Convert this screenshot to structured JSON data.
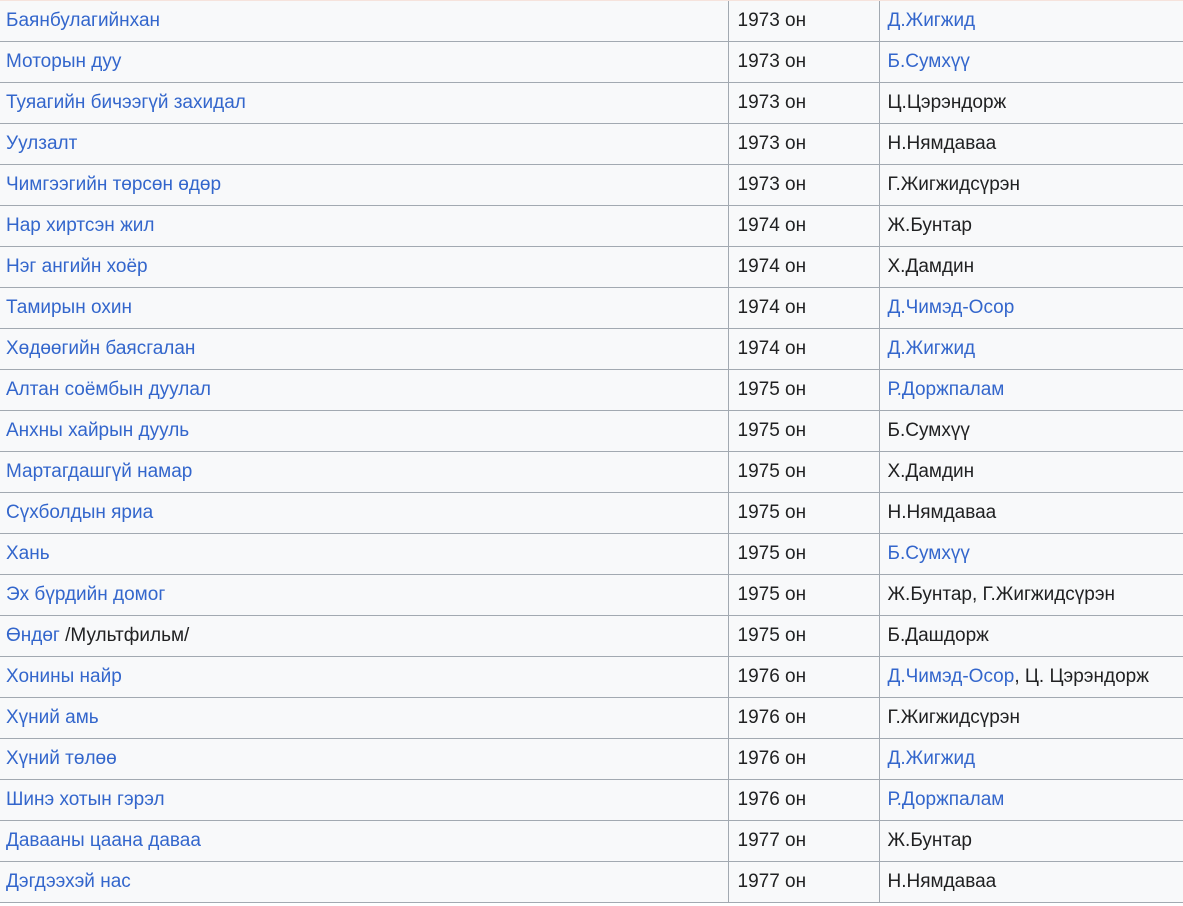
{
  "rows": [
    {
      "title": [
        {
          "text": "Баянбулагийнхан",
          "link": true
        }
      ],
      "year": "1973 он",
      "authors": [
        {
          "text": "Д.Жигжид",
          "link": true
        }
      ]
    },
    {
      "title": [
        {
          "text": "Моторын дуу",
          "link": true
        }
      ],
      "year": "1973 он",
      "authors": [
        {
          "text": "Б.Сумхүү",
          "link": true
        }
      ]
    },
    {
      "title": [
        {
          "text": "Туяагийн бичээгүй захидал",
          "link": true
        }
      ],
      "year": "1973 он",
      "authors": [
        {
          "text": "Ц.Цэрэндорж",
          "link": false
        }
      ]
    },
    {
      "title": [
        {
          "text": "Уулзалт",
          "link": true
        }
      ],
      "year": "1973 он",
      "authors": [
        {
          "text": "Н.Нямдаваа",
          "link": false
        }
      ]
    },
    {
      "title": [
        {
          "text": "Чимгээгийн төрсөн өдөр",
          "link": true
        }
      ],
      "year": "1973 он",
      "authors": [
        {
          "text": "Г.Жигжидсүрэн",
          "link": false
        }
      ]
    },
    {
      "title": [
        {
          "text": "Нар хиртсэн жил",
          "link": true
        }
      ],
      "year": "1974 он",
      "authors": [
        {
          "text": "Ж.Бунтар",
          "link": false
        }
      ]
    },
    {
      "title": [
        {
          "text": "Нэг ангийн хоёр",
          "link": true
        }
      ],
      "year": "1974 он",
      "authors": [
        {
          "text": "Х.Дамдин",
          "link": false
        }
      ]
    },
    {
      "title": [
        {
          "text": "Тамирын охин",
          "link": true
        }
      ],
      "year": "1974 он",
      "authors": [
        {
          "text": "Д.Чимэд-Осор",
          "link": true
        }
      ]
    },
    {
      "title": [
        {
          "text": "Хөдөөгийн баясгалан",
          "link": true
        }
      ],
      "year": "1974 он",
      "authors": [
        {
          "text": "Д.Жигжид",
          "link": true
        }
      ]
    },
    {
      "title": [
        {
          "text": "Алтан соёмбын дуулал",
          "link": true
        }
      ],
      "year": "1975 он",
      "authors": [
        {
          "text": "Р.Доржпалам",
          "link": true
        }
      ]
    },
    {
      "title": [
        {
          "text": "Анхны хайрын дууль",
          "link": true
        }
      ],
      "year": "1975 он",
      "authors": [
        {
          "text": "Б.Сумхүү",
          "link": false
        }
      ]
    },
    {
      "title": [
        {
          "text": "Мартагдашгүй намар",
          "link": true
        }
      ],
      "year": "1975 он",
      "authors": [
        {
          "text": "Х.Дамдин",
          "link": false
        }
      ]
    },
    {
      "title": [
        {
          "text": "Сүхболдын яриа",
          "link": true
        }
      ],
      "year": "1975 он",
      "authors": [
        {
          "text": "Н.Нямдаваа",
          "link": false
        }
      ]
    },
    {
      "title": [
        {
          "text": "Хань",
          "link": true
        }
      ],
      "year": "1975 он",
      "authors": [
        {
          "text": "Б.Сумхүү",
          "link": true
        }
      ]
    },
    {
      "title": [
        {
          "text": "Эх бүрдийн домог",
          "link": true
        }
      ],
      "year": "1975 он",
      "authors": [
        {
          "text": "Ж.Бунтар, Г.Жигжидсүрэн",
          "link": false
        }
      ]
    },
    {
      "title": [
        {
          "text": "Өндөг",
          "link": true
        },
        {
          "text": " /Мультфильм/",
          "link": false
        }
      ],
      "year": "1975 он",
      "authors": [
        {
          "text": "Б.Дашдорж",
          "link": false
        }
      ]
    },
    {
      "title": [
        {
          "text": "Хонины найр",
          "link": true
        }
      ],
      "year": "1976 он",
      "authors": [
        {
          "text": "Д.Чимэд-Осор",
          "link": true
        },
        {
          "text": ", Ц. Цэрэндорж",
          "link": false
        }
      ]
    },
    {
      "title": [
        {
          "text": "Хүний амь",
          "link": true
        }
      ],
      "year": "1976 он",
      "authors": [
        {
          "text": "Г.Жигжидсүрэн",
          "link": false
        }
      ]
    },
    {
      "title": [
        {
          "text": "Хүний төлөө",
          "link": true
        }
      ],
      "year": "1976 он",
      "authors": [
        {
          "text": "Д.Жигжид",
          "link": true
        }
      ]
    },
    {
      "title": [
        {
          "text": "Шинэ хотын гэрэл",
          "link": true
        }
      ],
      "year": "1976 он",
      "authors": [
        {
          "text": "Р.Доржпалам",
          "link": true
        }
      ]
    },
    {
      "title": [
        {
          "text": "Давааны цаана даваа",
          "link": true
        }
      ],
      "year": "1977 он",
      "authors": [
        {
          "text": "Ж.Бунтар",
          "link": false
        }
      ]
    },
    {
      "title": [
        {
          "text": "Дэгдээхэй нас",
          "link": true
        }
      ],
      "year": "1977 он",
      "authors": [
        {
          "text": "Н.Нямдаваа",
          "link": false
        }
      ]
    }
  ],
  "colors": {
    "link": "#3366cc",
    "text": "#202122",
    "border": "#a2a9b1",
    "row_background": "#f8f9fa"
  }
}
